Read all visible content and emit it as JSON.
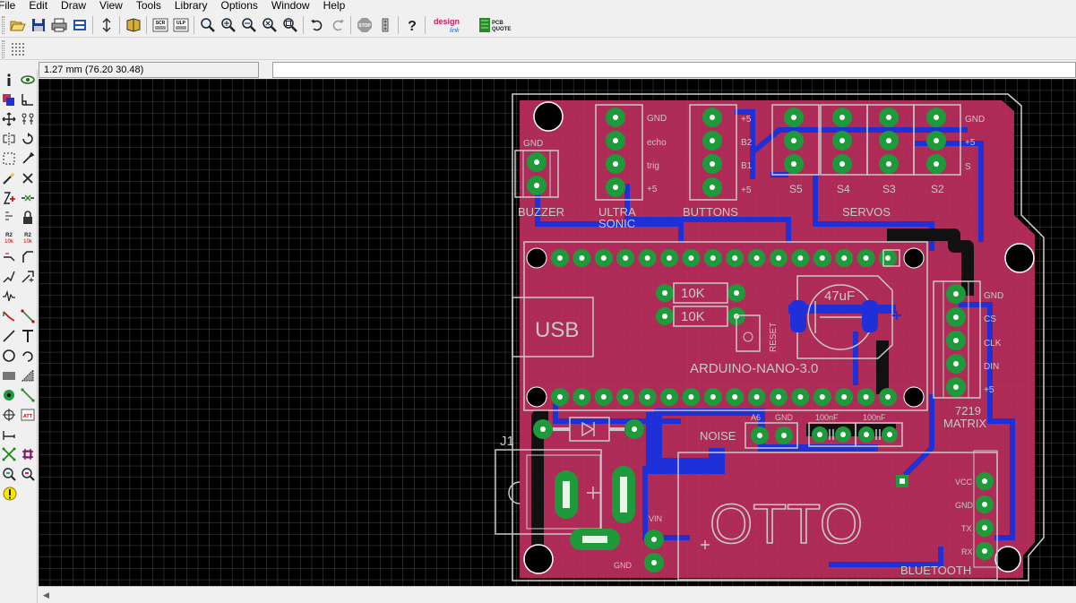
{
  "menu": [
    {
      "label": "File",
      "key": "F"
    },
    {
      "label": "Edit",
      "key": "E"
    },
    {
      "label": "Draw",
      "key": "D"
    },
    {
      "label": "View",
      "key": "V"
    },
    {
      "label": "Tools",
      "key": "T"
    },
    {
      "label": "Library",
      "key": "L"
    },
    {
      "label": "Options",
      "key": "O"
    },
    {
      "label": "Window",
      "key": "W"
    },
    {
      "label": "Help",
      "key": "H"
    }
  ],
  "toolbar": {
    "buttons": [
      "open-icon",
      "save-icon",
      "print-icon",
      "cam-processor-icon",
      "script-icon",
      "board-icon",
      "sch-icon",
      "ulp-icon",
      "zoom-fit-icon",
      "zoom-in-icon",
      "zoom-out-icon",
      "zoom-redraw-icon",
      "zoom-select-icon",
      "undo-icon",
      "redo-icon",
      "stop-icon",
      "go-icon",
      "help-icon"
    ],
    "stop_label": "STOP",
    "sch_label": "SCR",
    "ulp_label": "ULP",
    "designlink_top": "design",
    "designlink_bottom": "link",
    "pcb_quote_top": "PCB",
    "pcb_quote_bottom": "QUOTE"
  },
  "coordinates": {
    "readout": "1.27 mm (76.20 30.48)",
    "command_value": ""
  },
  "palette": {
    "tools": [
      "info-icon",
      "show-icon",
      "display-icon",
      "mark-icon",
      "move-icon",
      "copy-icon",
      "mirror-icon",
      "rotate-icon",
      "group-icon",
      "change-icon",
      "paste-icon",
      "delete-icon",
      "add-icon",
      "pinswap-icon",
      "replace-icon",
      "lock-icon",
      "name-icon",
      "value-icon",
      "smash-icon",
      "miter-icon",
      "split-icon",
      "optimize-icon",
      "route-icon",
      "ripup-icon",
      "wire-icon",
      "text-icon",
      "circle-icon",
      "arc-icon",
      "rect-icon",
      "polygon-icon",
      "via-icon",
      "signal-icon",
      "hole-icon",
      "attribute-icon",
      "dimension-icon",
      "ratsnest-icon",
      "autorouter-icon",
      "erc-icon",
      "drc-icon",
      "errors-icon"
    ],
    "name_label_top": "R2",
    "name_label_bottom": "10k",
    "value_label_top": "R2",
    "value_label_bottom": "10k",
    "attr_label": "ATT"
  },
  "board": {
    "colors": {
      "background": "#000000",
      "grid": "#4a4a4a",
      "top_copper": "#c0305f",
      "bottom_copper": "#2030d8",
      "pad": "#1f9a3a",
      "silk": "#c8c8c8",
      "outline": "#d0d0d0"
    },
    "labels": {
      "buzzer": "BUZZER",
      "buzzer_gnd": "GND",
      "ultra": "ULTRA",
      "sonic": "SONIC",
      "echo": "echo",
      "trig": "trig",
      "ultra_gnd": "GND",
      "ultra_plus": "+5",
      "buttons": "BUTTONS",
      "b_plus1": "+5",
      "b_b2": "B2",
      "b_b1": "B1",
      "b_plus2": "+5",
      "servos": "SERVOS",
      "s5": "S5",
      "s4": "S4",
      "s3": "S3",
      "s2": "S2",
      "servo_gnd": "GND",
      "servo_plus": "+5",
      "servo_s": "S",
      "usb": "USB",
      "r1": "10K",
      "r2": "10K",
      "reset": "RESET",
      "cap": "47uF",
      "nano": "ARDUINO-NANO-3.0",
      "matrix_gnd": "GND",
      "matrix_cs": "CS",
      "matrix_clk": "CLK",
      "matrix_din": "DIN",
      "matrix_plus": "+5",
      "matrix_7219": "7219",
      "matrix": "MATRIX",
      "j1": "J1",
      "noise": "NOISE",
      "a6": "A6",
      "noise_gnd": "GND",
      "c1": "100nF",
      "c2": "100nF",
      "vin": "VIN",
      "vin_gnd": "GND",
      "otto": "OTTO",
      "bt_vcc": "VCC",
      "bt_gnd": "GND",
      "bt_tx": "TX",
      "bt_rx": "RX",
      "bluetooth": "BLUETOOTH"
    }
  }
}
